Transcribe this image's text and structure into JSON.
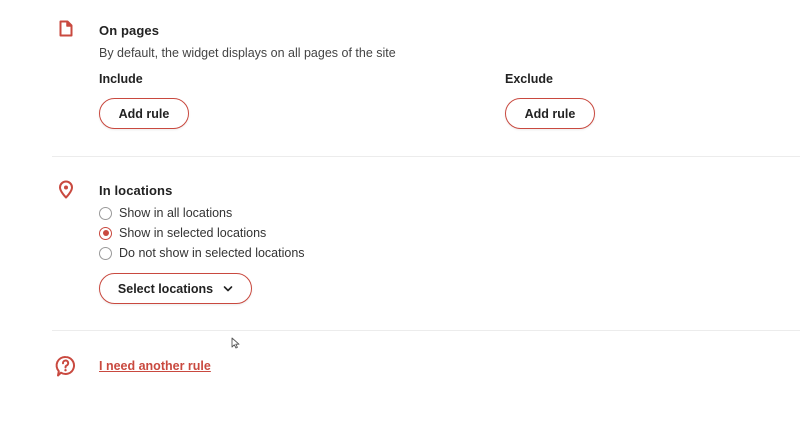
{
  "pages_section": {
    "icon": "document-icon",
    "title": "On pages",
    "description": "By default, the widget displays on all pages of the site",
    "include_label": "Include",
    "exclude_label": "Exclude",
    "include_button": "Add rule",
    "exclude_button": "Add rule"
  },
  "locations_section": {
    "icon": "location-pin-icon",
    "title": "In locations",
    "options": [
      {
        "label": "Show in all locations",
        "selected": false
      },
      {
        "label": "Show in selected locations",
        "selected": true
      },
      {
        "label": "Do not show in selected locations",
        "selected": false
      }
    ],
    "select_button": "Select locations"
  },
  "help_section": {
    "icon": "question-bubble-icon",
    "link_text": "I need another rule"
  },
  "colors": {
    "accent": "#c9493f"
  }
}
